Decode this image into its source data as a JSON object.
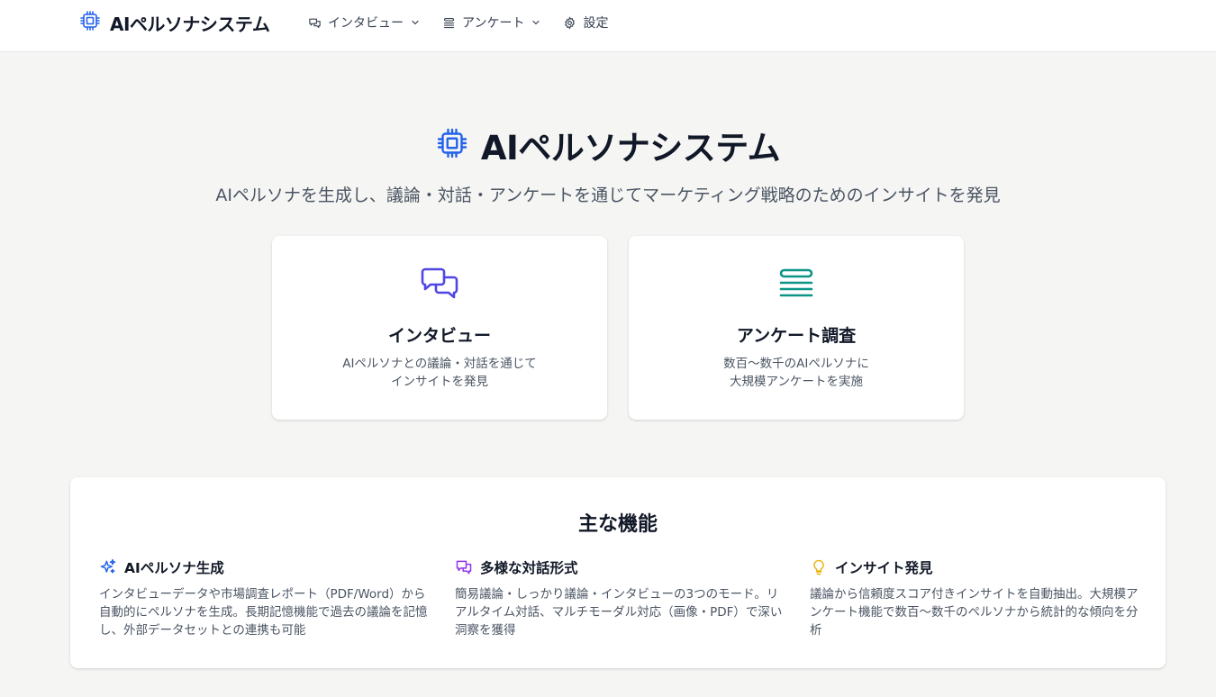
{
  "header": {
    "brand": "AIペルソナシステム",
    "nav": {
      "interview": "インタビュー",
      "survey": "アンケート",
      "settings": "設定"
    }
  },
  "hero": {
    "title": "AIペルソナシステム",
    "subtitle": "AIペルソナを生成し、議論・対話・アンケートを通じてマーケティング戦略のためのインサイトを発見"
  },
  "cards": [
    {
      "title": "インタビュー",
      "description": "AIペルソナとの議論・対話を通じて\nインサイトを発見",
      "icon": "chat-bubbles-icon",
      "color": "#4f46e5"
    },
    {
      "title": "アンケート調査",
      "description": "数百〜数千のAIペルソナに\n大規模アンケートを実施",
      "icon": "stack-list-icon",
      "color": "#0d9488"
    }
  ],
  "features": {
    "title": "主な機能",
    "items": [
      {
        "title": "AIペルソナ生成",
        "description": "インタビューデータや市場調査レポート（PDF/Word）から自動的にペルソナを生成。長期記憶機能で過去の議論を記憶し、外部データセットとの連携も可能",
        "icon": "sparkles-icon",
        "color": "#2563eb"
      },
      {
        "title": "多様な対話形式",
        "description": "簡易議論・しっかり議論・インタビューの3つのモード。リアルタイム対話、マルチモーダル対応（画像・PDF）で深い洞察を獲得",
        "icon": "chat-bubbles-icon",
        "color": "#9333ea"
      },
      {
        "title": "インサイト発見",
        "description": "議論から信頼度スコア付きインサイトを自動抽出。大規模アンケート機能で数百〜数千のペルソナから統計的な傾向を分析",
        "icon": "lightbulb-icon",
        "color": "#eab308"
      }
    ]
  },
  "colors": {
    "brand_icon": "#2563eb",
    "background": "#f5f5f4"
  }
}
